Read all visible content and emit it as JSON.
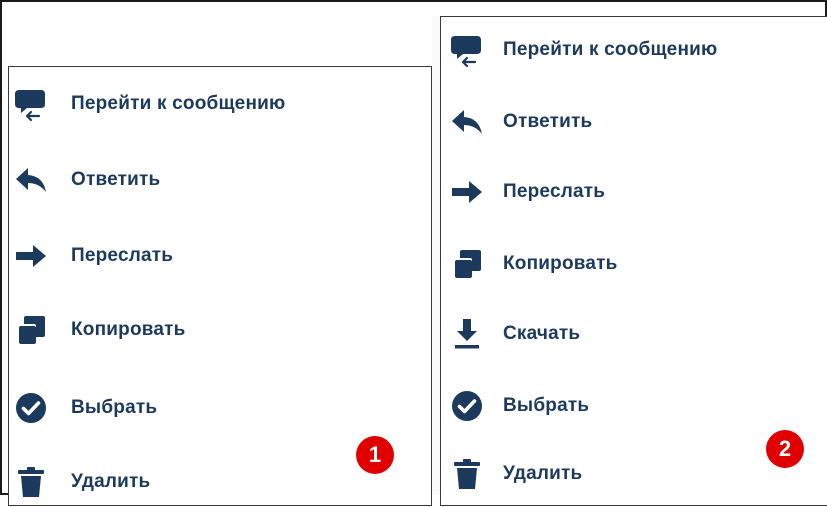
{
  "menus": [
    {
      "items": [
        {
          "label": "Перейти к сообщению",
          "icon": "go-to-message-icon"
        },
        {
          "label": "Ответить",
          "icon": "reply-icon"
        },
        {
          "label": "Переслать",
          "icon": "forward-icon"
        },
        {
          "label": "Копировать",
          "icon": "copy-icon"
        },
        {
          "label": "Выбрать",
          "icon": "select-check-icon"
        },
        {
          "label": "Удалить",
          "icon": "trash-icon"
        }
      ],
      "badge": "1"
    },
    {
      "items": [
        {
          "label": "Перейти к сообщению",
          "icon": "go-to-message-icon"
        },
        {
          "label": "Ответить",
          "icon": "reply-icon"
        },
        {
          "label": "Переслать",
          "icon": "forward-icon"
        },
        {
          "label": "Копировать",
          "icon": "copy-icon"
        },
        {
          "label": "Скачать",
          "icon": "download-icon"
        },
        {
          "label": "Выбрать",
          "icon": "select-check-icon"
        },
        {
          "label": "Удалить",
          "icon": "trash-icon"
        }
      ],
      "badge": "2"
    }
  ],
  "colors": {
    "icon": "#1c3a5e",
    "text": "#1c3a5e",
    "badge": "#e00000"
  }
}
